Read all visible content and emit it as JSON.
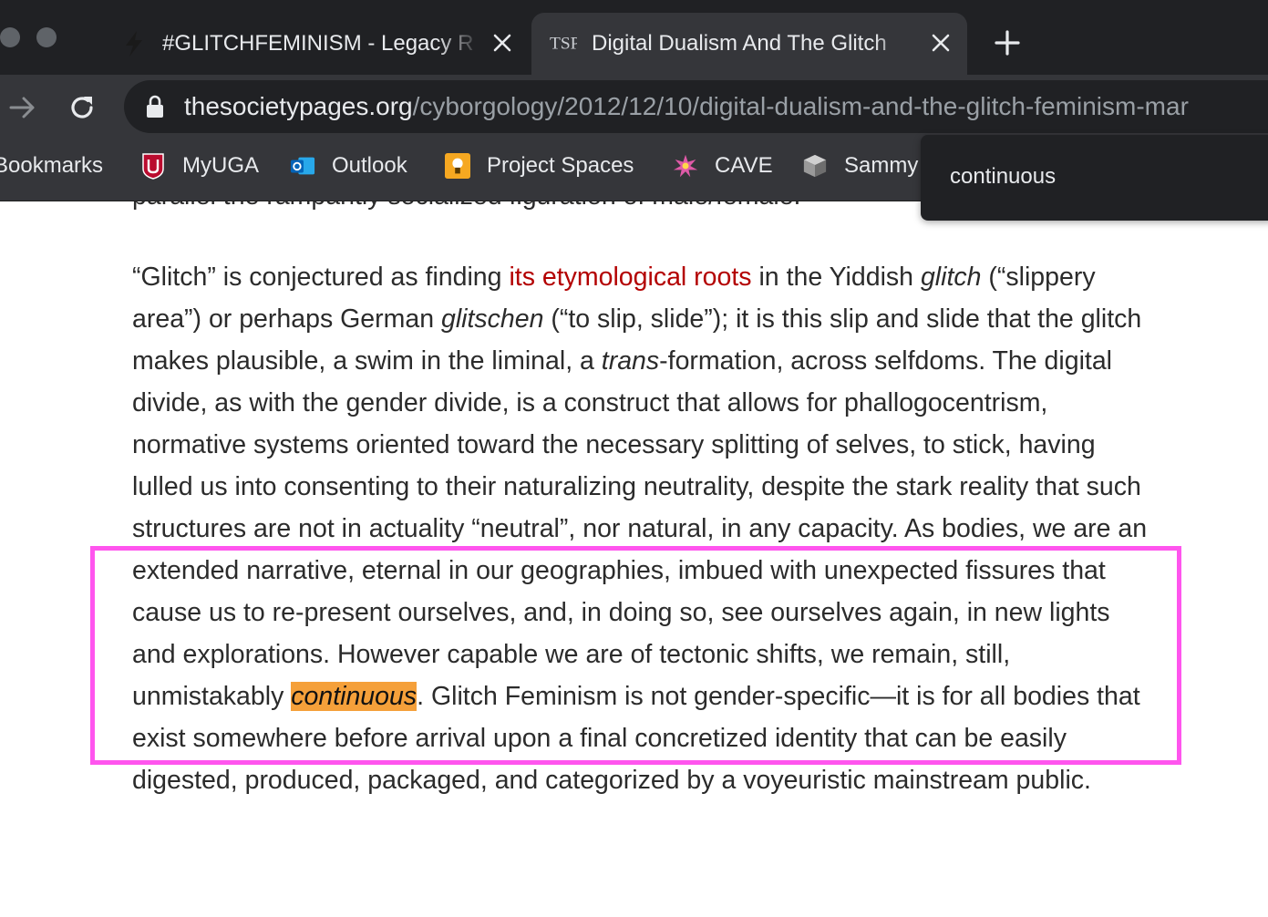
{
  "browser": {
    "tabs": [
      {
        "title": "#GLITCHFEMINISM - Legacy R",
        "active": false,
        "icon": "bolt-icon"
      },
      {
        "title": "Digital Dualism And The Glitch",
        "active": true,
        "icon": "tsp-favicon"
      }
    ],
    "url": {
      "host": "thesocietypages.org",
      "path": "/cyborgology/2012/12/10/digital-dualism-and-the-glitch-feminism-mar"
    },
    "favicon_text": "TSP",
    "bookmarks": [
      {
        "label": "Bookmarks"
      },
      {
        "label": "MyUGA",
        "icon": "uga-shield-icon"
      },
      {
        "label": "Outlook",
        "icon": "outlook-icon"
      },
      {
        "label": "Project Spaces",
        "icon": "project-spaces-icon"
      },
      {
        "label": "CAVE",
        "icon": "cave-icon"
      },
      {
        "label": "Sammy",
        "icon": "cube-icon"
      }
    ],
    "tooltip": "continuous"
  },
  "article": {
    "previous_line": "parallel the rampantly socialized figuration of male/female.",
    "p1": "“Glitch” is conjectured as finding ",
    "p1_link": "its etymological roots",
    "p2": " in the Yiddish ",
    "p2_em": "glitch",
    "p3": " (“slippery area”) or perhaps German ",
    "p3_em": "glitschen",
    "p4": " (“to slip, slide”); it is this slip and slide that the glitch makes plausible, a swim in the liminal, a ",
    "p4_em": "trans",
    "p5": "-formation, across selfdoms. The digital divide, as with the gender divide, is a construct that allows for phallogocentrism, normative systems oriented toward the necessary splitting of selves, to stick, having lulled us into consenting to their naturalizing neutrality, despite the stark reality that such structures are not in actuality “neutral”, nor natural, in any capacity. As bodies, we are an extended narrative, eternal in our geographies, imbued with unexpected fissures that cause us to re-present ourselves, and, in doing so, see ourselves again, in new lights and explorations. However capable we are of tectonic shifts, we remain, still, unmistakably ",
    "highlight": "continuous",
    "p6": ". Glitch Feminism is not gender-specific—it is for all bodies that exist somewhere before arrival upon a final concretized identity that can be easily digested, produced, packaged, and categorized by a voyeuristic mainstream public."
  },
  "colors": {
    "highlight": "#f5a03a",
    "selection_outline": "#ff55ee",
    "link": "#b30000"
  }
}
